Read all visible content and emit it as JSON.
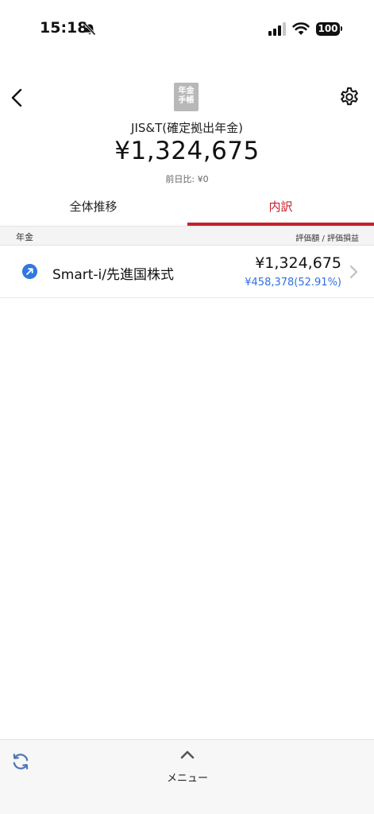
{
  "status_bar": {
    "time": "15:18",
    "battery": "100",
    "icons": [
      "bell-slash-icon",
      "signal-icon",
      "wifi-icon",
      "battery-icon"
    ]
  },
  "header": {
    "logo_line1": "年金",
    "logo_line2": "手帳",
    "account_name": "JIS&T(確定拠出年金)",
    "total_amount": "¥1,324,675",
    "day_change": "前日比: ¥0",
    "icons": [
      "back-chevron-icon",
      "gear-icon"
    ]
  },
  "tabs": [
    {
      "label": "全体推移",
      "active": false
    },
    {
      "label": "内訳",
      "active": true
    }
  ],
  "section": {
    "left_label": "年金",
    "right_label": "評価額 / 評価損益"
  },
  "funds": [
    {
      "name": "Smart-i/先進国株式",
      "value": "¥1,324,675",
      "gain": "¥458,378(52.91%)",
      "icon": "trend-up-icon"
    }
  ],
  "bottom_bar": {
    "menu_label": "メニュー",
    "icons": [
      "refresh-icon",
      "chevron-up-icon"
    ]
  },
  "colors": {
    "accent": "#c8202c",
    "gain_blue": "#2f6fe0",
    "trend_icon_blue": "#2f78e0"
  }
}
